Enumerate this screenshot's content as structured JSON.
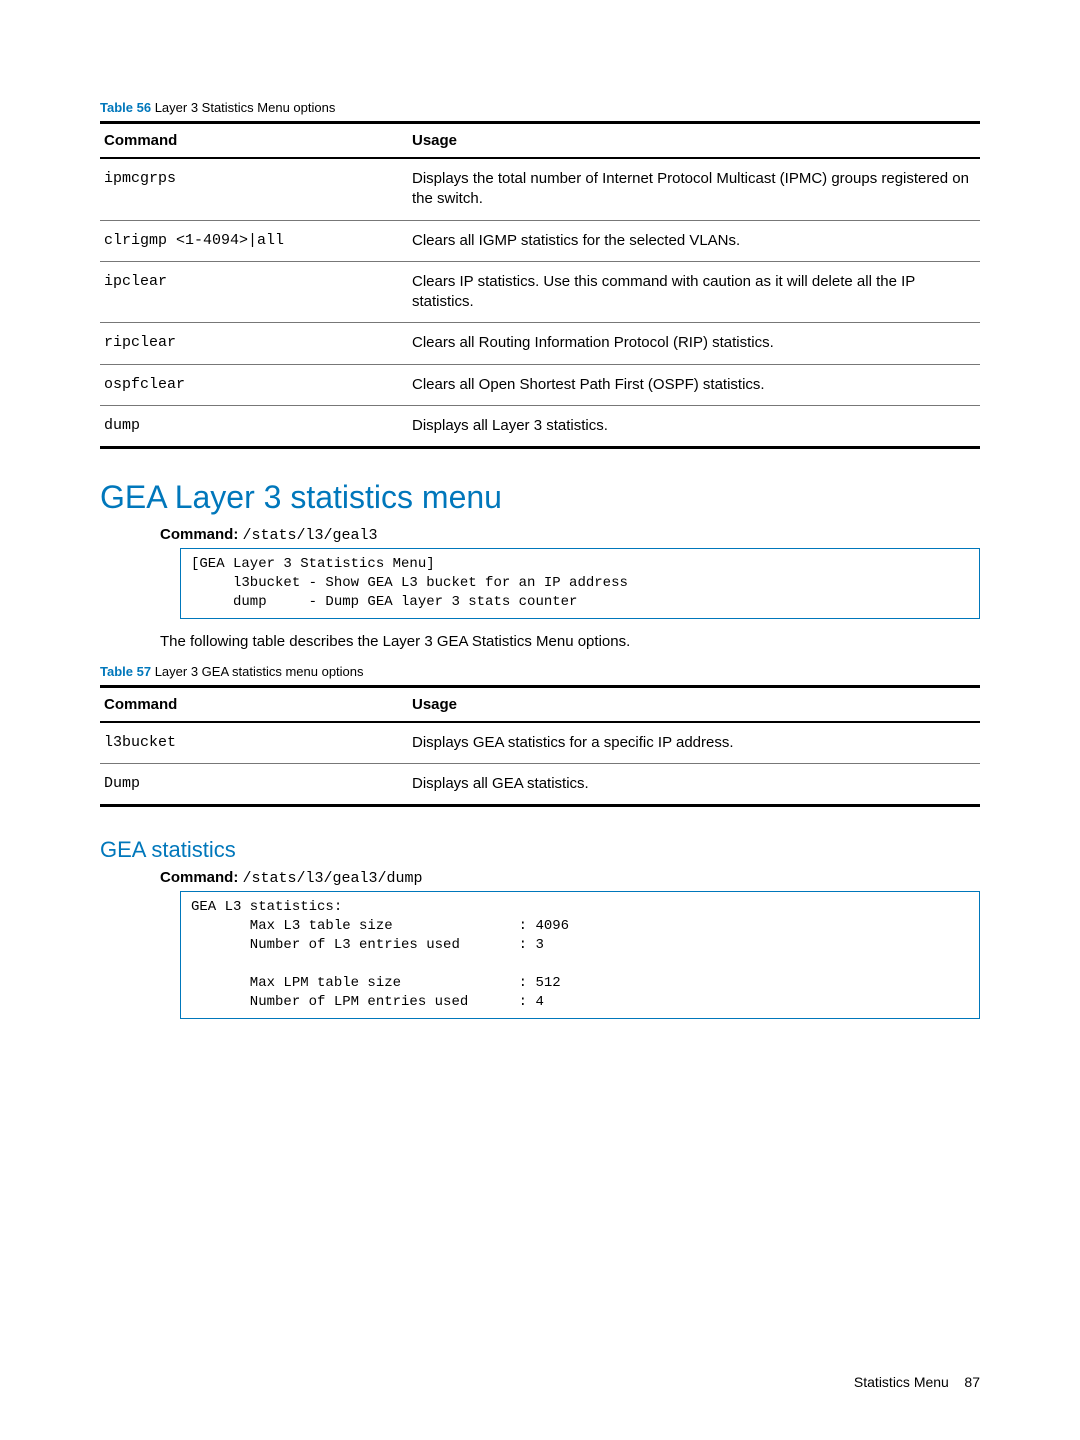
{
  "table56": {
    "caption_label": "Table 56",
    "caption_text": "Layer 3 Statistics Menu options",
    "head_cmd": "Command",
    "head_usage": "Usage",
    "rows": [
      {
        "cmd": "ipmcgrps",
        "usage": "Displays the total number of Internet Protocol Multicast (IPMC) groups registered on the switch."
      },
      {
        "cmd": "clrigmp <1-4094>|all",
        "usage": "Clears all IGMP statistics for the selected VLANs."
      },
      {
        "cmd": "ipclear",
        "usage": "Clears IP statistics. Use this command with caution as it will delete all the IP statistics."
      },
      {
        "cmd": "ripclear",
        "usage": "Clears all Routing Information Protocol (RIP) statistics."
      },
      {
        "cmd": "ospfclear",
        "usage": "Clears all Open Shortest Path First (OSPF) statistics."
      },
      {
        "cmd": "dump",
        "usage": "Displays all Layer 3 statistics."
      }
    ]
  },
  "section1": {
    "heading": "GEA Layer 3 statistics menu",
    "cmd_label": "Command:",
    "cmd_path": "/stats/l3/geal3",
    "codebox": "[GEA Layer 3 Statistics Menu]\n     l3bucket - Show GEA L3 bucket for an IP address\n     dump     - Dump GEA layer 3 stats counter",
    "following_text": "The following table describes the Layer 3 GEA Statistics Menu options."
  },
  "table57": {
    "caption_label": "Table 57",
    "caption_text": "Layer 3 GEA statistics menu options",
    "head_cmd": "Command",
    "head_usage": "Usage",
    "rows": [
      {
        "cmd": "l3bucket",
        "usage": "Displays GEA statistics for a specific IP address."
      },
      {
        "cmd": "Dump",
        "usage": "Displays all GEA statistics."
      }
    ]
  },
  "section2": {
    "heading": "GEA statistics",
    "cmd_label": "Command:",
    "cmd_path": "/stats/l3/geal3/dump",
    "codebox": "GEA L3 statistics:\n       Max L3 table size               : 4096\n       Number of L3 entries used       : 3\n\n       Max LPM table size              : 512\n       Number of LPM entries used      : 4"
  },
  "footer": {
    "text": "Statistics Menu",
    "page": "87"
  },
  "chart_data": {
    "type": "table",
    "title": "GEA L3 statistics",
    "rows": [
      {
        "label": "Max L3 table size",
        "value": 4096
      },
      {
        "label": "Number of L3 entries used",
        "value": 3
      },
      {
        "label": "Max LPM table size",
        "value": 512
      },
      {
        "label": "Number of LPM entries used",
        "value": 4
      }
    ]
  }
}
